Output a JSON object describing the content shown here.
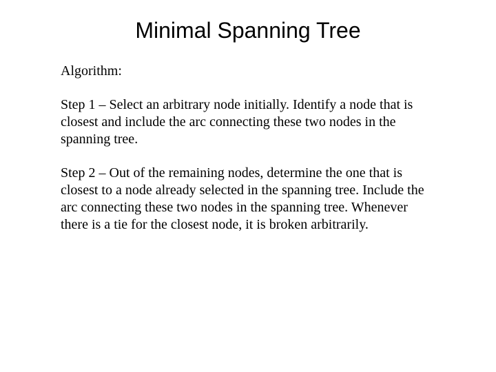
{
  "title": "Minimal Spanning Tree",
  "body": {
    "intro": "Algorithm:",
    "step1": "Step 1 – Select an arbitrary node initially.  Identify a node that is closest and include the arc connecting these two nodes in the spanning tree.",
    "step2": "Step 2 – Out of the remaining nodes, determine the one that is closest to a node already selected in the spanning tree.  Include the arc connecting these two nodes in the spanning tree.  Whenever there is a tie for the closest node, it is broken arbitrarily."
  }
}
